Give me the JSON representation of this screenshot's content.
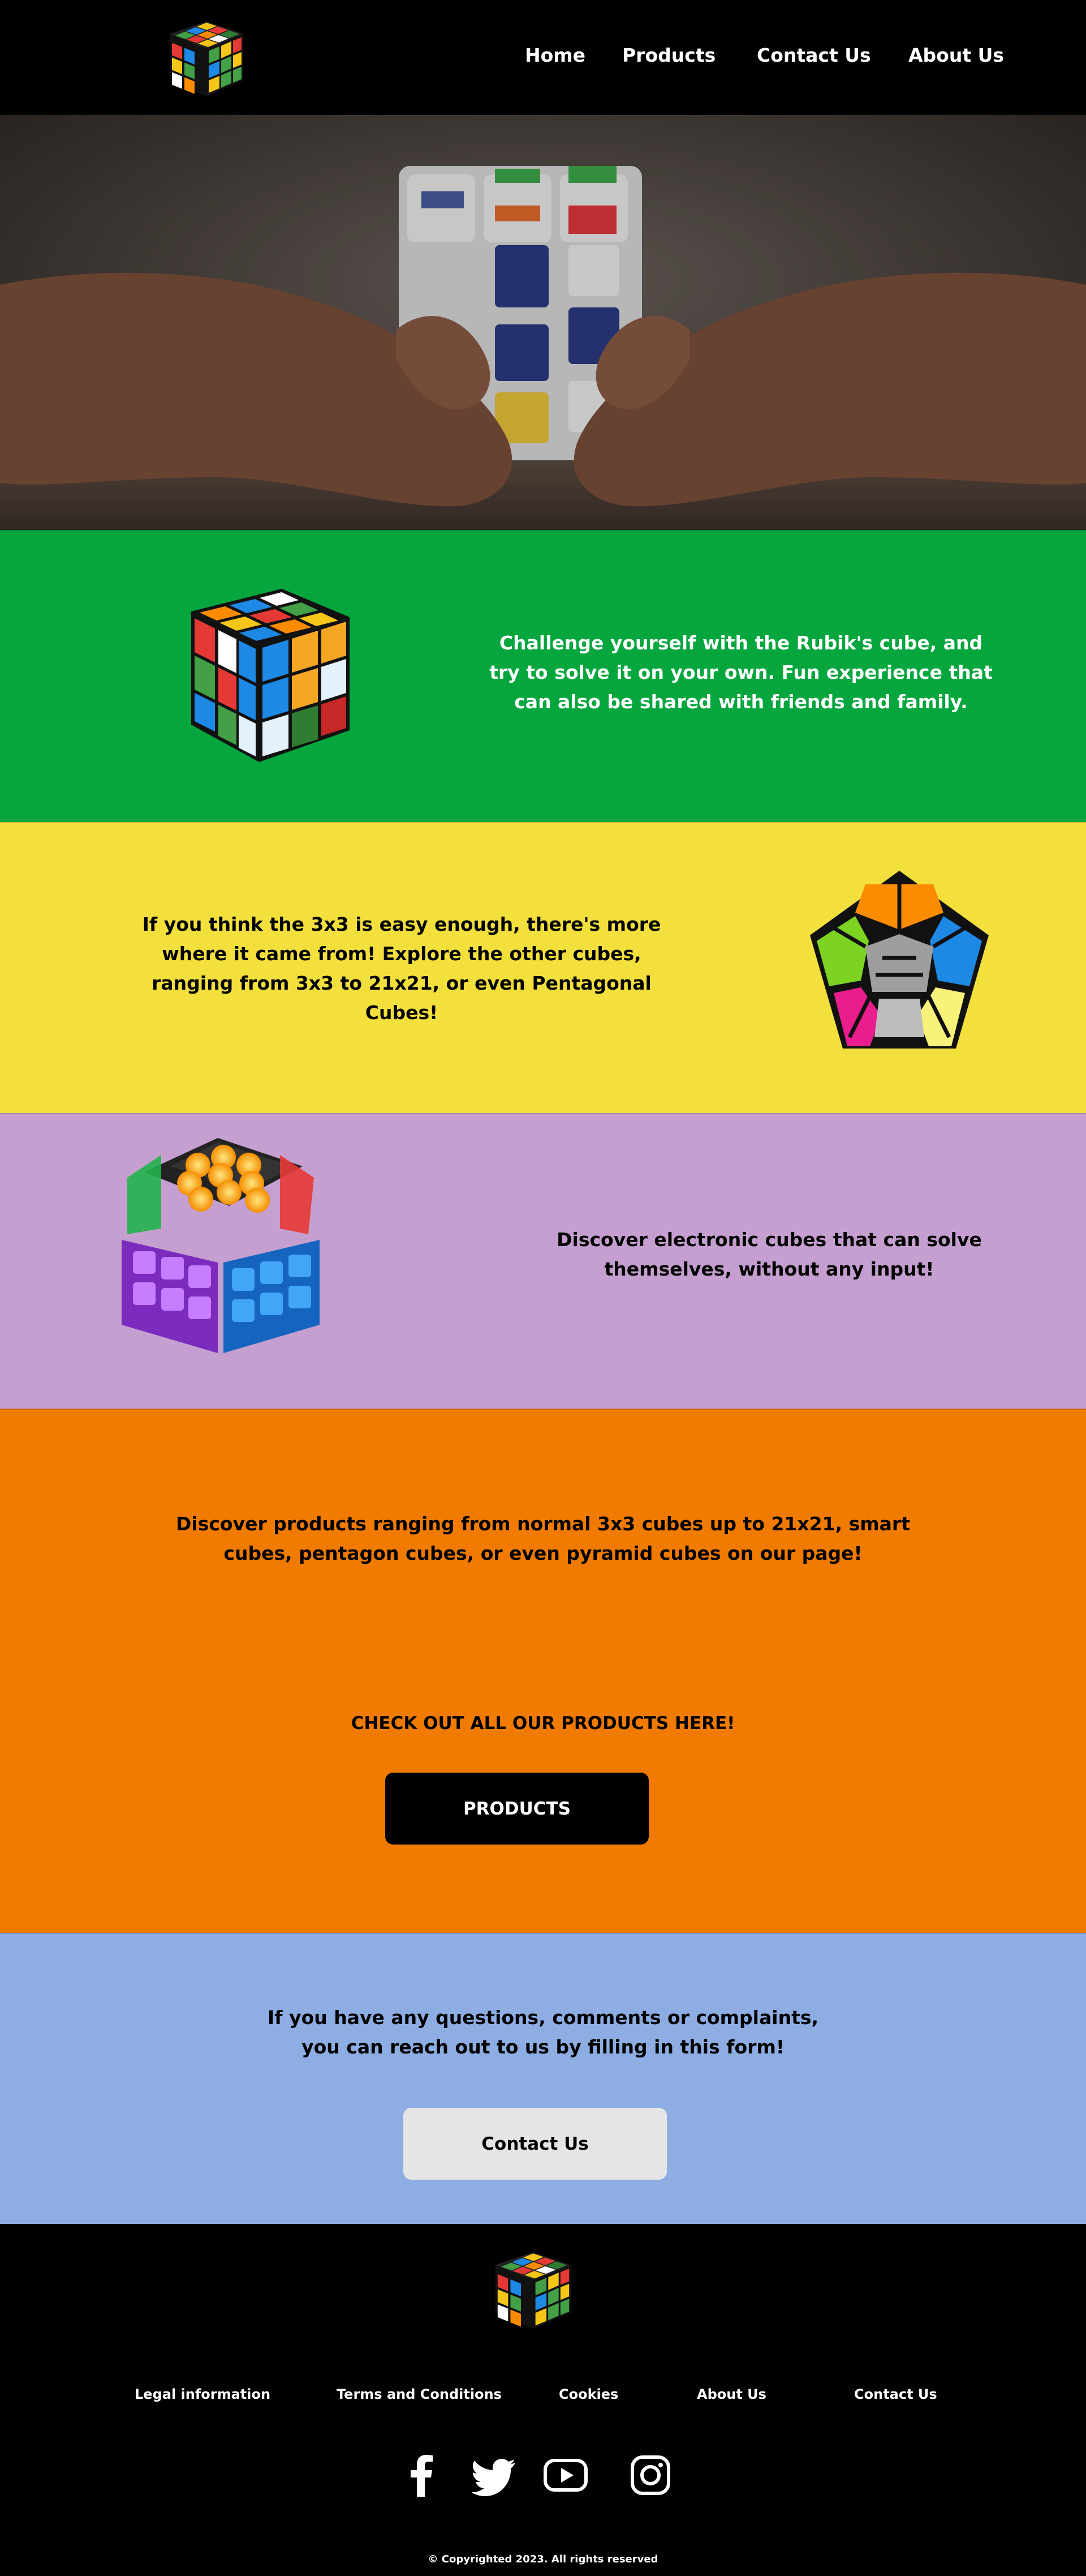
{
  "header": {
    "logo_alt": "Rubik's cube logo",
    "nav": [
      "Home",
      "Products",
      "Contact Us",
      "About Us"
    ]
  },
  "sections": {
    "green_text": "Challenge yourself with the Rubik's cube, and try to solve it on your own. Fun experience that can also be shared with friends and family.",
    "yellow_text": "If you think the 3x3 is easy enough, there's more where it came from! Explore the other cubes, ranging from 3x3 to 21x21, or even Pentagonal Cubes!",
    "purple_text": "Discover electronic cubes that can solve themselves, without any input!",
    "orange_text": "Discover products ranging from normal 3x3 cubes up to 21x21, smart cubes, pentagon cubes, or even pyramid cubes on our page!",
    "orange_cta": "CHECK OUT ALL OUR PRODUCTS HERE!",
    "products_button": "PRODUCTS",
    "blue_text": "If you have any questions, comments or complaints, you can reach out to us by filling in this form!",
    "contact_button": "Contact Us"
  },
  "footer": {
    "links": [
      "Legal information",
      "Terms and Conditions",
      "Cookies",
      "About Us",
      "Contact Us"
    ],
    "social": [
      "facebook-icon",
      "twitter-icon",
      "youtube-icon",
      "instagram-icon"
    ],
    "copyright": "© Copyrighted 2023. All rights reserved"
  },
  "colors": {
    "header_bg": "#000000",
    "green": "#04a63d",
    "yellow": "#f4e03c",
    "purple": "#c59fcf",
    "orange": "#f07b00",
    "blue": "#8dade3",
    "button_dark": "#000000",
    "button_light": "#e5e5e5"
  }
}
